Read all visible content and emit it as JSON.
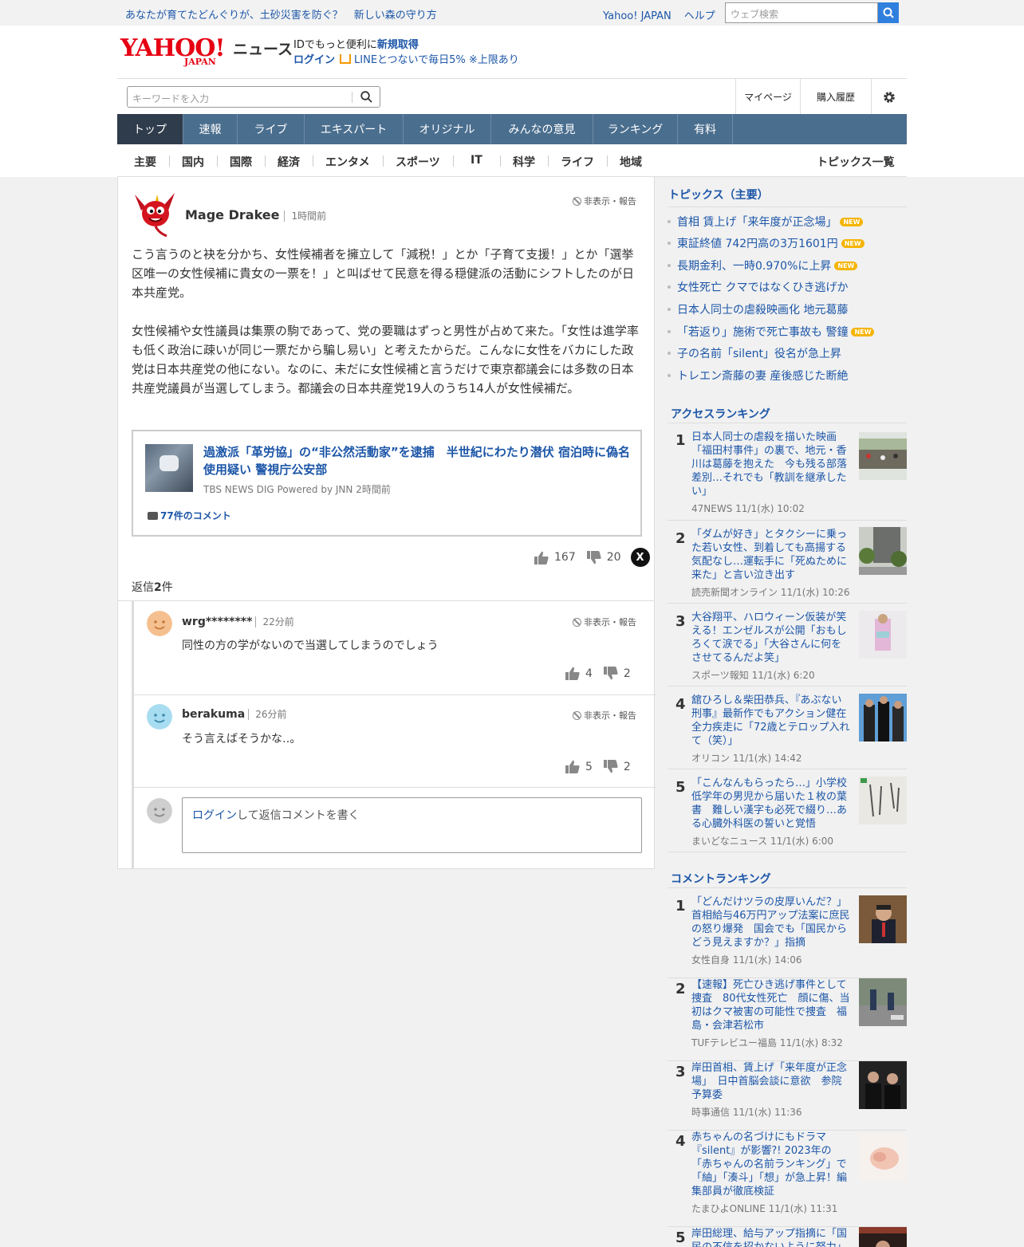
{
  "header": {
    "promo": [
      "あなたが育てたどんぐりが、土砂災害を防ぐ？",
      "新しい森の守り方"
    ],
    "links": [
      "Yahoo! JAPAN",
      "ヘルプ"
    ],
    "web_search_placeholder": "ウェブ検索",
    "logo_text": "YAHOO!",
    "logo_sub": "JAPAN",
    "service_name": "ニュース",
    "id_line1_prefix": "IDでもっと便利に",
    "id_line1_link": "新規取得",
    "login": "ログイン",
    "line_promo": "LINEとつないで毎日5% ※上限あり"
  },
  "search": {
    "placeholder": "キーワードを入力",
    "mypage": "マイページ",
    "history": "購入履歴"
  },
  "global_nav": [
    {
      "label": "トップ",
      "active": true
    },
    {
      "label": "速報",
      "active": false
    },
    {
      "label": "ライブ",
      "active": false
    },
    {
      "label": "エキスパート",
      "active": false
    },
    {
      "label": "オリジナル",
      "active": false
    },
    {
      "label": "みんなの意見",
      "active": false
    },
    {
      "label": "ランキング",
      "active": false
    },
    {
      "label": "有料",
      "active": false
    }
  ],
  "sub_nav": [
    "主要",
    "国内",
    "国際",
    "経済",
    "エンタメ",
    "スポーツ",
    "IT",
    "科学",
    "ライフ",
    "地域"
  ],
  "sub_nav_right": "トピックス一覧",
  "comment": {
    "author": "Mage Drakee",
    "time": "1時間前",
    "hide_report": "非表示・報告",
    "paragraphs": [
      "こう言うのと袂を分かち、女性候補者を擁立して「減税！」とか「子育て支援！」とか「選挙区唯一の女性候補に貴女の一票を！」と叫ばせて民意を得る穏健派の活動にシフトしたのが日本共産党。",
      "女性候補や女性議員は集票の駒であって、党の要職はずっと男性が占めて来た。「女性は進学率も低く政治に疎いが同じ一票だから騙し易い」と考えたからだ。こんなに女性をバカにした政党は日本共産党の他にない。なのに、未だに女性候補と言うだけで東京都議会には多数の日本共産党議員が当選してしまう。都議会の日本共産党19人のうち14人が女性候補だ。"
    ],
    "article": {
      "title": "過激派「革労協」の“非公然活動家”を逮捕　半世紀にわたり潜伏 宿泊時に偽名使用疑い 警視庁公安部",
      "source": "TBS NEWS DIG Powered by JNN 2時間前",
      "comments": "77件のコメント"
    },
    "likes": "167",
    "dislikes": "20",
    "share": "X",
    "reply_count_prefix": "返信",
    "reply_count_num": "2",
    "reply_count_suffix": "件"
  },
  "replies": [
    {
      "name": "wrg********",
      "time": "22分前",
      "text": "同性の方の学がないので当選してしまうのでしょう",
      "likes": "4",
      "dislikes": "2",
      "face_color": "#f5c08f"
    },
    {
      "name": "berakuma",
      "time": "26分前",
      "text": "そう言えばそうかな‥。",
      "likes": "5",
      "dislikes": "2",
      "face_color": "#a8dcf0"
    }
  ],
  "reply_box": {
    "login": "ログイン",
    "rest": "して返信コメントを書く"
  },
  "topics": {
    "heading": "トピックス（主要）",
    "items": [
      {
        "text": "首相 賃上げ「来年度が正念場」",
        "new": true
      },
      {
        "text": "東証終値 742円高の3万1601円",
        "new": true
      },
      {
        "text": "長期金利、一時0.970%に上昇",
        "new": true
      },
      {
        "text": "女性死亡 クマではなくひき逃げか",
        "new": false
      },
      {
        "text": "日本人同士の虐殺映画化 地元葛藤",
        "new": false
      },
      {
        "text": "「若返り」施術で死亡事故も 警鐘",
        "new": true
      },
      {
        "text": "子の名前「silent」役名が急上昇",
        "new": false
      },
      {
        "text": "トレエン斎藤の妻 産後感じた断絶",
        "new": false
      }
    ],
    "new_label": "NEW"
  },
  "access_ranking": {
    "heading": "アクセスランキング",
    "items": [
      {
        "rank": "1",
        "title": "日本人同士の虐殺を描いた映画「福田村事件」の裏で、地元・香川は葛藤を抱えた　今も残る部落差別…それでも「教訓を継承したい」",
        "source": "47NEWS 11/1(水) 10:02"
      },
      {
        "rank": "2",
        "title": "「ダムが好き」とタクシーに乗った若い女性、到着しても高揚する気配なし…運転手に「死ぬために来た」と言い泣き出す",
        "source": "読売新聞オンライン 11/1(水) 10:26"
      },
      {
        "rank": "3",
        "title": "大谷翔平、ハロウィーン仮装が笑える！エンゼルスが公開「おもしろくて涙でる」「大谷さんに何をさせてるんだよ笑」",
        "source": "スポーツ報知 11/1(水) 6:20"
      },
      {
        "rank": "4",
        "title": "舘ひろし＆柴田恭兵、『あぶない刑事』最新作でもアクション健在　全力疾走に「72歳とテロップ入れて（笑）」",
        "source": "オリコン 11/1(水) 14:42"
      },
      {
        "rank": "5",
        "title": "「こんなんもらったら…」小学校低学年の男児から届いた１枚の葉書　難しい漢字も必死で綴り…ある心臓外科医の誓いと覚悟",
        "source": "まいどなニュース 11/1(水) 6:00"
      }
    ]
  },
  "comment_ranking": {
    "heading": "コメントランキング",
    "items": [
      {
        "rank": "1",
        "title": "「どんだけツラの皮厚いんだ？」首相給与46万円アップ法案に庶民の怒り爆発　国会でも「国民からどう見えますか？」指摘",
        "source": "女性自身 11/1(水) 14:06"
      },
      {
        "rank": "2",
        "title": "【速報】死亡ひき逃げ事件として捜査　80代女性死亡　顔に傷、当初はクマ被害の可能性で捜査　福島・会津若松市",
        "source": "TUFテレビユー福島 11/1(水) 8:32"
      },
      {
        "rank": "3",
        "title": "岸田首相、賃上げ「来年度が正念場」　日中首脳会談に意欲　参院予算委",
        "source": "時事通信 11/1(水) 11:36"
      },
      {
        "rank": "4",
        "title": "赤ちゃんの名づけにもドラマ『silent』が影響?! 2023年の「赤ちゃんの名前ランキング」で「紬」「湊斗」「想」が急上昇！編集部員が徹底検証",
        "source": "たまひよONLINE 11/1(水) 11:31"
      },
      {
        "rank": "5",
        "title": "岸田総理、給与アップ指摘に「国民の不信を招かないように努力」",
        "source": ""
      }
    ]
  }
}
